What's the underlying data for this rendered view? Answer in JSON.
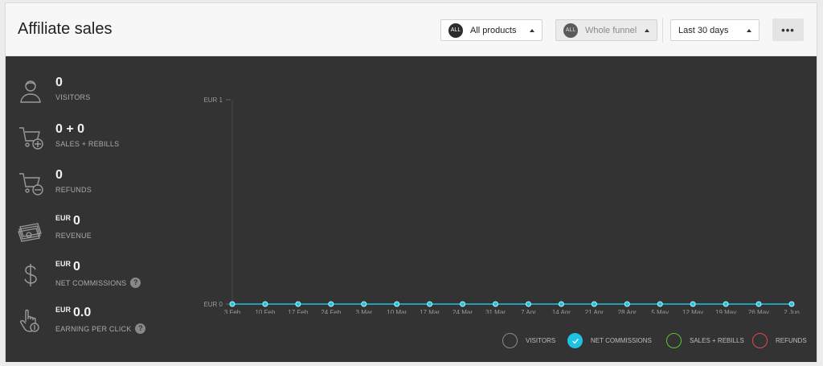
{
  "header": {
    "title": "Affiliate sales",
    "products": {
      "badge": "ALL",
      "label": "All products"
    },
    "funnel": {
      "badge": "ALL",
      "label": "Whole funnel"
    },
    "period": {
      "label": "Last 30 days"
    },
    "more_label": "•••"
  },
  "metrics": [
    {
      "icon": "person-icon",
      "value": "0",
      "label": "VISITORS"
    },
    {
      "icon": "cart-plus-icon",
      "value": "0 + 0",
      "label": "SALES + REBILLS"
    },
    {
      "icon": "cart-minus-icon",
      "value": "0",
      "label": "REFUNDS"
    },
    {
      "icon": "banknotes-icon",
      "currency": "EUR",
      "value": "0",
      "label": "REVENUE"
    },
    {
      "icon": "dollar-icon",
      "currency": "EUR",
      "value": "0",
      "label": "NET COMMISSIONS",
      "help": "?"
    },
    {
      "icon": "click-coin-icon",
      "currency": "EUR",
      "value": "0.0",
      "label": "EARNING PER CLICK",
      "help": "?"
    }
  ],
  "chart_data": {
    "type": "line",
    "x": [
      "3 Feb",
      "10 Feb",
      "17 Feb",
      "24 Feb",
      "3 Mar",
      "10 Mar",
      "17 Mar",
      "24 Mar",
      "31 Mar",
      "7 Apr",
      "14 Apr",
      "21 Apr",
      "28 Apr",
      "5 May",
      "12 May",
      "19 May",
      "26 May",
      "2 Jun"
    ],
    "y_ticks": [
      "EUR 0",
      "EUR 1"
    ],
    "ylim": [
      0,
      1
    ],
    "series": [
      {
        "name": "NET COMMISSIONS",
        "color": "#1cc3e3",
        "values": [
          0,
          0,
          0,
          0,
          0,
          0,
          0,
          0,
          0,
          0,
          0,
          0,
          0,
          0,
          0,
          0,
          0,
          0
        ]
      }
    ]
  },
  "legend": [
    {
      "label": "VISITORS",
      "color": "#8a8a8a",
      "checked": false
    },
    {
      "label": "NET COMMISSIONS",
      "color": "#1cc3e3",
      "checked": true
    },
    {
      "label": "SALES + REBILLS",
      "color": "#5cc431",
      "checked": false
    },
    {
      "label": "REFUNDS",
      "color": "#e24b4b",
      "checked": false
    }
  ]
}
